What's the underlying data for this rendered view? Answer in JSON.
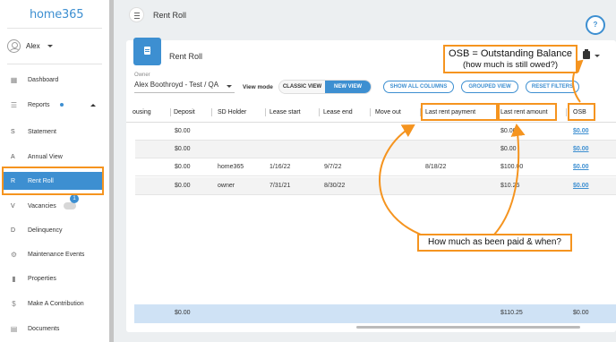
{
  "app": {
    "logo": "home365"
  },
  "user": {
    "name": "Alex"
  },
  "sidebar": {
    "items": [
      {
        "label": "Dashboard",
        "icon": "dashboard-icon"
      },
      {
        "label": "Reports",
        "icon": "reports-icon"
      },
      {
        "label": "Statement",
        "letter": "S"
      },
      {
        "label": "Annual View",
        "letter": "A"
      },
      {
        "label": "Rent Roll",
        "letter": "R"
      },
      {
        "label": "Vacancies",
        "letter": "V",
        "badge": "1"
      },
      {
        "label": "Delinquency",
        "letter": "D"
      },
      {
        "label": "Maintenance Events",
        "icon": "wrench-icon"
      },
      {
        "label": "Properties",
        "icon": "buildings-icon"
      },
      {
        "label": "Make A Contribution",
        "icon": "dollar-icon"
      },
      {
        "label": "Documents",
        "icon": "documents-icon"
      }
    ]
  },
  "header": {
    "title": "Rent Roll",
    "help_icon": "?"
  },
  "card": {
    "title": "Rent Roll",
    "owner_label": "Owner",
    "owner_value": "Alex Boothroyd - Test / QA",
    "view_mode_label": "View mode",
    "classic_view": "CLASSIC VIEW",
    "new_view": "NEW VIEW",
    "show_all_columns": "SHOW ALL COLUMNS",
    "grouped_view": "GROUPED VIEW",
    "reset_filters": "RESET FILTERS"
  },
  "table": {
    "columns": [
      "ousing",
      "Deposit",
      "SD Holder",
      "Lease start",
      "Lease end",
      "Move out",
      "Last rent payment",
      "Last rent amount",
      "OSB"
    ],
    "rows": [
      [
        "",
        "$0.00",
        "",
        "",
        "",
        "",
        "",
        "$0.00",
        "$0.00"
      ],
      [
        "",
        "$0.00",
        "",
        "",
        "",
        "",
        "",
        "$0.00",
        "$0.00"
      ],
      [
        "",
        "$0.00",
        "home365",
        "1/16/22",
        "9/7/22",
        "",
        "8/18/22",
        "$100.00",
        "$0.00"
      ],
      [
        "",
        "$0.00",
        "owner",
        "7/31/21",
        "8/30/22",
        "",
        "",
        "$10.25",
        "$0.00"
      ]
    ],
    "footer": {
      "deposit": "$0.00",
      "last_rent_amount": "$110.25",
      "osb": "$0.00"
    }
  },
  "annotations": {
    "osb_line1": "OSB = Outstanding Balance",
    "osb_line2": "(how much is still owed?)",
    "paid_note": "How much as been paid & when?",
    "color": "#f5941f"
  }
}
